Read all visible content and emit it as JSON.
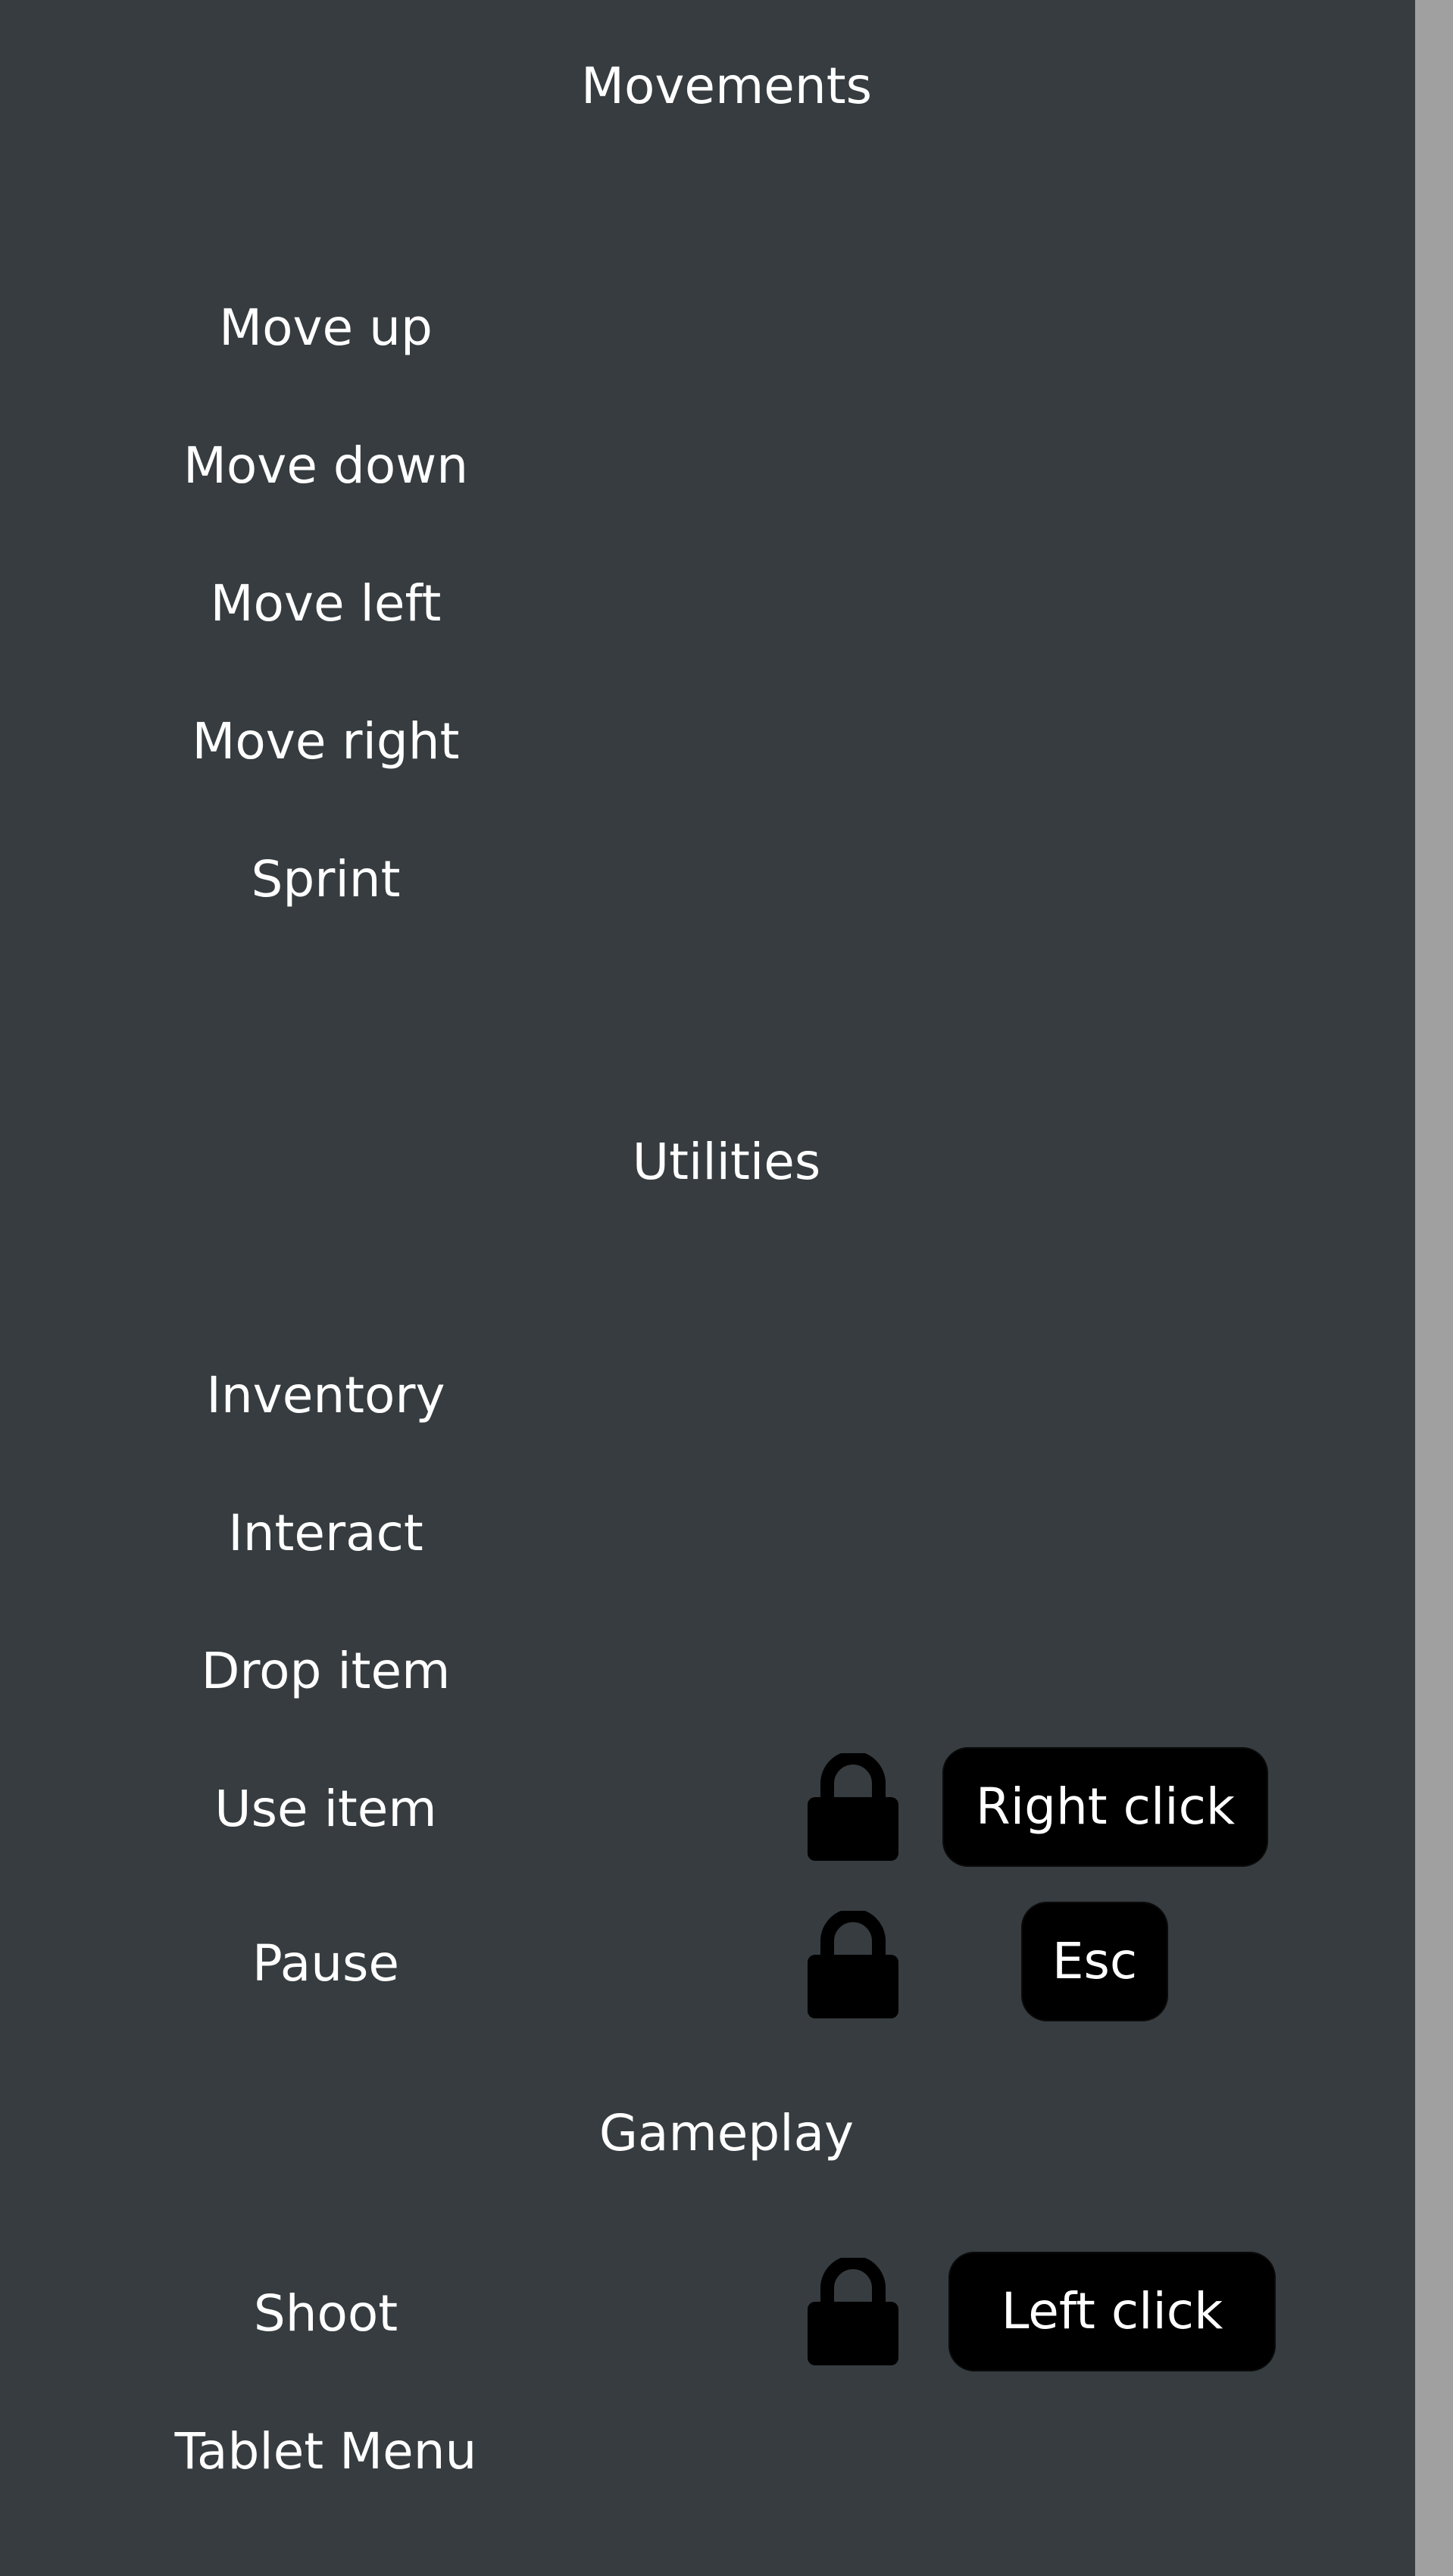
{
  "sections": {
    "movements": {
      "title": "Movements",
      "rows": [
        {
          "label": "Move up"
        },
        {
          "label": "Move down"
        },
        {
          "label": "Move left"
        },
        {
          "label": "Move right"
        },
        {
          "label": "Sprint"
        }
      ]
    },
    "utilities": {
      "title": "Utilities",
      "rows": [
        {
          "label": "Inventory"
        },
        {
          "label": "Interact"
        },
        {
          "label": "Drop item"
        },
        {
          "label": "Use item",
          "locked": true,
          "key": "Right click",
          "icon": "lock-icon"
        },
        {
          "label": "Pause",
          "locked": true,
          "key": "Esc",
          "icon": "lock-icon"
        }
      ]
    },
    "gameplay": {
      "title": "Gameplay",
      "rows": [
        {
          "label": "Shoot",
          "locked": true,
          "key": "Left click",
          "icon": "lock-icon"
        },
        {
          "label": "Tablet Menu"
        }
      ]
    }
  },
  "colors": {
    "panel_background": "#363c3f",
    "scrollbar": "#a0a0a0",
    "text": "#ffffff",
    "key_button": "#000000",
    "lock_icon": "#000000"
  }
}
